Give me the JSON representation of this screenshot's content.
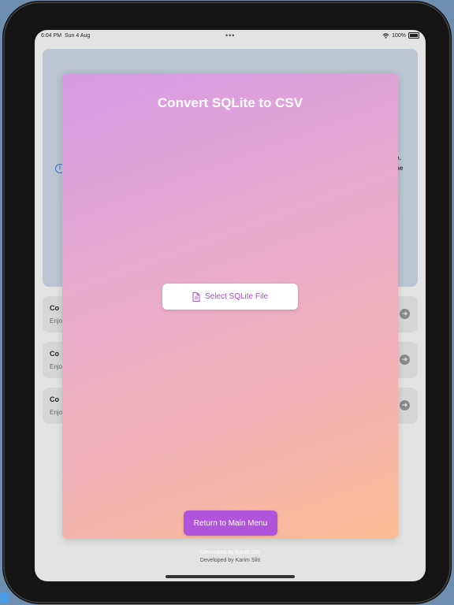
{
  "status_bar": {
    "time": "6:04 PM",
    "date": "Sun 4 Aug",
    "multitask_dots": "•••",
    "battery": "100%"
  },
  "background_app": {
    "fragments": [
      "e.",
      "ne"
    ],
    "rows": [
      {
        "title_fragment": "Co",
        "subtitle_fragment": "Enjo"
      },
      {
        "title_fragment": "Co",
        "subtitle_fragment": "Enjo"
      },
      {
        "title_fragment": "Co",
        "subtitle_fragment": "Enjo"
      }
    ],
    "footer": "Developed by Karim Sliti"
  },
  "sheet": {
    "title": "Convert SQLite to CSV",
    "select_button_label": "Select SQLite File",
    "return_button_label": "Return to Main Menu",
    "credit": "Developed by Karim Sliti"
  },
  "colors": {
    "gradient_start": "#d69ae6",
    "gradient_end": "#fbbd93",
    "accent": "#b154dc",
    "select_text": "#a84bd0"
  },
  "icons": {
    "select_button": "document-icon",
    "wifi": "wifi-icon",
    "battery": "battery-icon",
    "info": "info-icon",
    "row_arrow": "arrow-right-circle-icon"
  }
}
